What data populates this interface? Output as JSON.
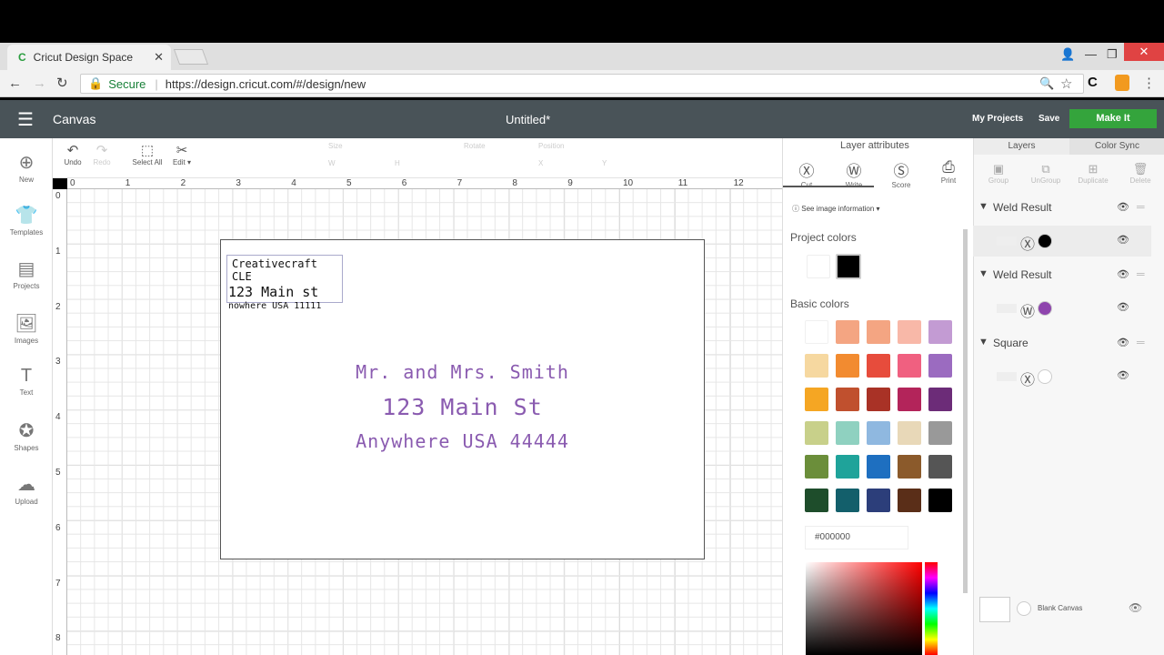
{
  "browser": {
    "tab_title": "Cricut Design Space",
    "secure_label": "Secure",
    "url": "https://design.cricut.com/#/design/new"
  },
  "header": {
    "section": "Canvas",
    "doc_title": "Untitled*",
    "my_projects": "My Projects",
    "save": "Save",
    "make_it": "Make It"
  },
  "toolbar": {
    "undo": "Undo",
    "redo": "Redo",
    "select_all": "Select All",
    "edit": "Edit",
    "size": "Size",
    "rotate": "Rotate",
    "position": "Position",
    "w": "W",
    "h": "H",
    "x": "X",
    "y": "Y"
  },
  "leftnav": [
    "New",
    "Templates",
    "Projects",
    "Images",
    "Text",
    "Shapes",
    "Upload"
  ],
  "ruler_h": [
    "0",
    "1",
    "2",
    "3",
    "4",
    "5",
    "6",
    "7",
    "8",
    "9",
    "10",
    "11",
    "12"
  ],
  "ruler_v": [
    "0",
    "1",
    "2",
    "3",
    "4",
    "5",
    "6",
    "7",
    "8"
  ],
  "card": {
    "return_lines": [
      "Creativecraft CLE",
      "123 Main st",
      "nowhere USA 11111"
    ],
    "address_lines": [
      "Mr. and Mrs. Smith",
      "123 Main St",
      "Anywhere USA 44444"
    ]
  },
  "attr": {
    "title": "Layer attributes",
    "tools": [
      "Cut",
      "Write",
      "Score",
      "Print"
    ],
    "info": "See image information",
    "project_colors": "Project colors",
    "basic_colors": "Basic colors",
    "hex": "#000000",
    "palette": [
      "#ffffff",
      "#f4a582",
      "#f4a582",
      "#f8b8a8",
      "#c39bd3",
      "#f6d8a0",
      "#f28b30",
      "#e74c3c",
      "#f06080",
      "#9b6bc0",
      "#f5a623",
      "#c0502e",
      "#a93226",
      "#b3245a",
      "#6c2c78",
      "#c8d08a",
      "#8fd1c0",
      "#8fb8e0",
      "#e8d8b8",
      "#999999",
      "#6b8e3a",
      "#1fa39a",
      "#1e6fc0",
      "#8b5a2b",
      "#555555",
      "#1e4d2b",
      "#135f6b",
      "#2c3e7a",
      "#5a2e18",
      "#000000"
    ]
  },
  "layers": {
    "tab_layers": "Layers",
    "tab_sync": "Color Sync",
    "actions": [
      "Group",
      "UnGroup",
      "Duplicate",
      "Delete"
    ],
    "groups": [
      {
        "name": "Weld Result",
        "color": "#000000"
      },
      {
        "name": "Weld Result",
        "color": "#8e44ad"
      },
      {
        "name": "Square",
        "color": "#ffffff"
      }
    ],
    "blank": "Blank Canvas"
  }
}
